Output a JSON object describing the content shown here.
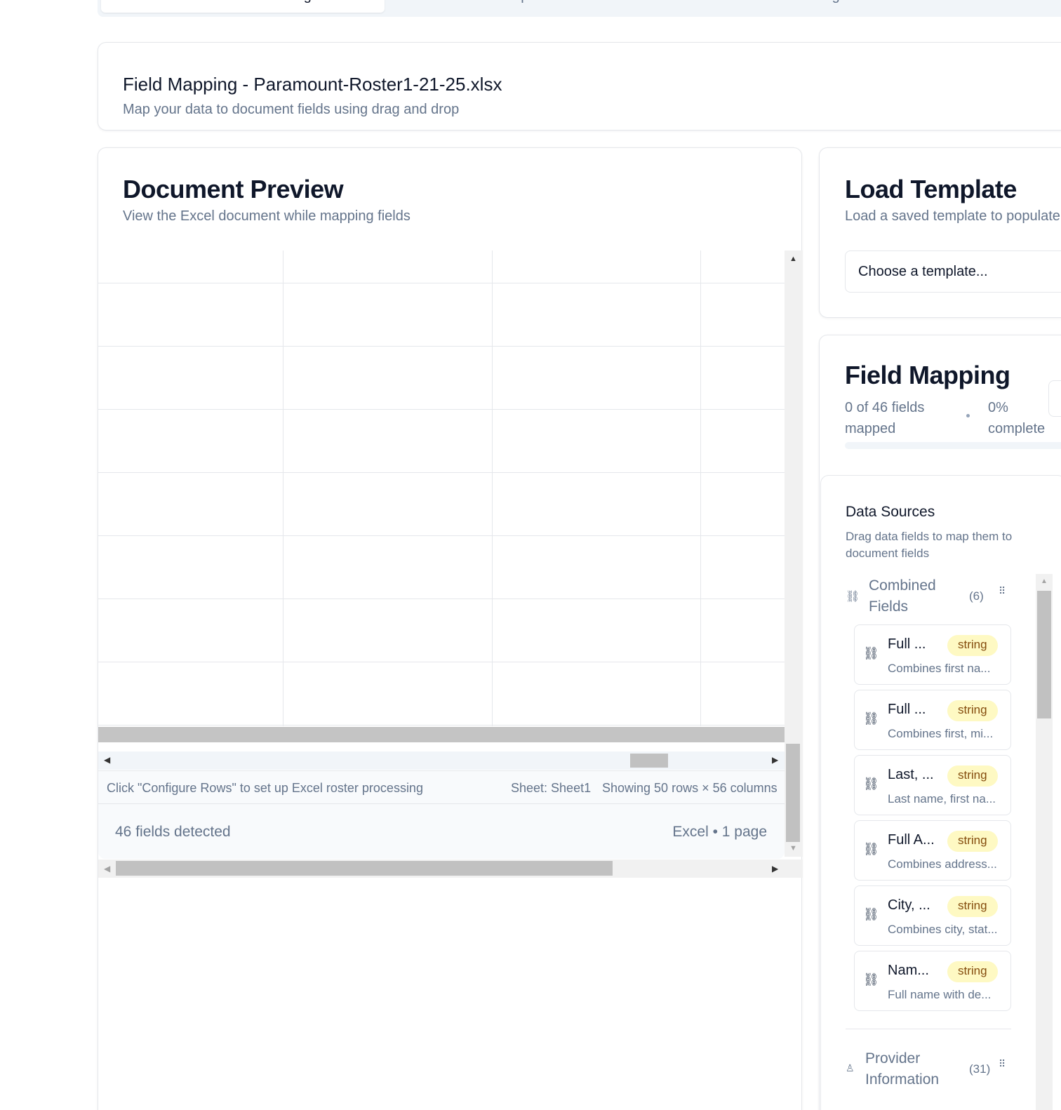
{
  "tabs": [
    {
      "label": "Document Processing",
      "active": true
    },
    {
      "label": "Templates",
      "active": false
    },
    {
      "label": "Provider Management",
      "active": false
    }
  ],
  "header": {
    "title": "Field Mapping - Paramount-Roster1-21-25.xlsx",
    "subtitle": "Map your data to document fields using drag and drop"
  },
  "preview": {
    "title": "Document Preview",
    "subtitle": "View the Excel document while mapping fields",
    "status_left": "Click \"Configure Rows\" to set up Excel roster processing",
    "sheet": "Sheet: Sheet1",
    "showing": "Showing 50 rows × 56 columns",
    "fields_detected": "46 fields detected",
    "doc_info": "Excel • 1 page"
  },
  "load_template": {
    "title": "Load Template",
    "subtitle": "Load a saved template to populate",
    "select_placeholder": "Choose a template..."
  },
  "field_mapping": {
    "title": "Field Mapping",
    "mapped_text": "0 of 46 fields mapped",
    "percent_text": "0% complete",
    "progress": 0
  },
  "data_sources": {
    "title": "Data Sources",
    "subtitle": "Drag data fields to map them to document fields",
    "groups": [
      {
        "label": "Combined Fields",
        "count": "(6)",
        "icon": "link-icon",
        "fields": [
          {
            "name": "Full ...",
            "type": "string",
            "desc": "Combines first na..."
          },
          {
            "name": "Full ...",
            "type": "string",
            "desc": "Combines first, mi..."
          },
          {
            "name": "Last, ...",
            "type": "string",
            "desc": "Last name, first na..."
          },
          {
            "name": "Full A...",
            "type": "string",
            "desc": "Combines address..."
          },
          {
            "name": "City, ...",
            "type": "string",
            "desc": "Combines city, stat..."
          },
          {
            "name": "Nam...",
            "type": "string",
            "desc": "Full name with de..."
          }
        ]
      },
      {
        "label": "Provider Information",
        "count": "(31)",
        "icon": "user-icon",
        "fields": []
      }
    ]
  },
  "colors": {
    "badge_bg": "#fef9c3",
    "badge_text": "#854d0e",
    "muted": "#64748b",
    "border": "#e5e7eb"
  }
}
